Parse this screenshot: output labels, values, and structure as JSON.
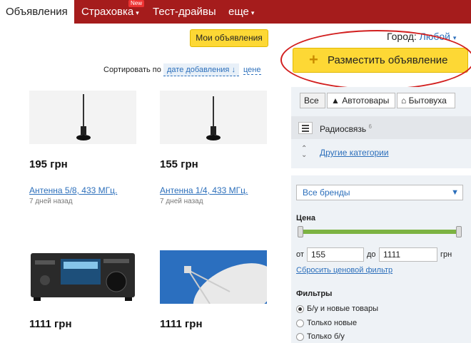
{
  "nav": {
    "tabs": [
      {
        "label": "Объявления",
        "active": true
      },
      {
        "label": "Страховка",
        "dropdown": true
      },
      {
        "label": "Тест-драйвы"
      },
      {
        "label": "еще",
        "dropdown": true
      }
    ],
    "new_badge": "New",
    "caret": "▾"
  },
  "my_ads_button": "Мои объявления",
  "city": {
    "label": "Город:",
    "value": "Любой"
  },
  "post_button": {
    "icon": "plus-icon",
    "label": "Разместить объявление"
  },
  "sort": {
    "label": "Сортировать по",
    "active": "дате добавления ↓",
    "alt": "цене"
  },
  "items": [
    {
      "price": "195 грн",
      "title": "Антенна 5/8, 433 МГц.",
      "time": "7 дней назад"
    },
    {
      "price": "155 грн",
      "title": "Антенна 1/4, 433 МГц.",
      "time": "7 дней назад"
    },
    {
      "price": "1111 грн"
    },
    {
      "price": "1111 грн"
    }
  ],
  "sidebar": {
    "segments": [
      {
        "label": "Все",
        "active": true
      },
      {
        "label": "Автотовары",
        "icon": "car-icon"
      },
      {
        "label": "Бытовуха",
        "icon": "home-icon"
      }
    ],
    "category": {
      "label": "Радиосвязь",
      "count": "6"
    },
    "other_categories": "Другие категории",
    "brand_select": "Все бренды",
    "price_label": "Цена",
    "price_from_label": "от",
    "price_from": "155",
    "price_to_label": "до",
    "price_to": "1111",
    "currency": "грн",
    "reset_price": "Сбросить ценовой фильтр",
    "filters_label": "Фильтры",
    "filters": [
      {
        "label": "Б/у и новые товары",
        "checked": true
      },
      {
        "label": "Только новые"
      },
      {
        "label": "Только б/у"
      }
    ]
  },
  "colors": {
    "nav_bg": "#a51c1c",
    "accent_yellow": "#fdd835",
    "link": "#2c6fbb",
    "slider": "#7cb342",
    "highlight": "#d21f1f"
  }
}
